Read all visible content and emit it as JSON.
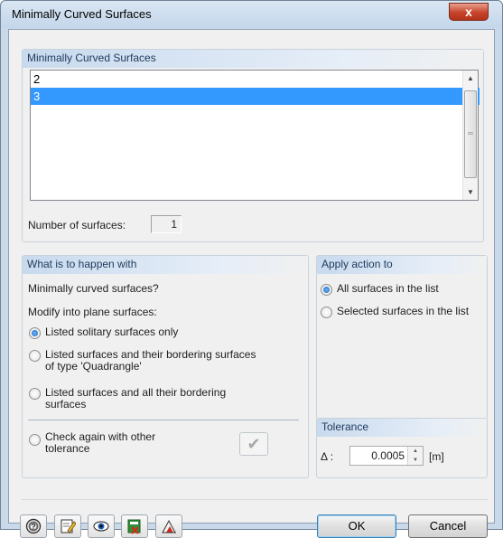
{
  "window": {
    "title": "Minimally Curved Surfaces",
    "close_label": "x"
  },
  "list_group": {
    "header": "Minimally Curved Surfaces",
    "items": [
      "2",
      "3"
    ],
    "selected_index": 1,
    "number_label": "Number of surfaces:",
    "number_value": "1"
  },
  "happen_group": {
    "header": "What is to happen with",
    "question": "Minimally curved surfaces?",
    "modify_label": "Modify into plane surfaces:",
    "options": [
      {
        "line1": "Listed solitary surfaces only",
        "line2": "",
        "checked": true
      },
      {
        "line1": "Listed surfaces and their bordering surfaces",
        "line2": "of type 'Quadrangle'",
        "checked": false
      },
      {
        "line1": "Listed surfaces and all their bordering",
        "line2": "surfaces",
        "checked": false
      },
      {
        "line1": "Check again with other",
        "line2": "tolerance",
        "checked": false
      }
    ],
    "check_icon": "checkmark-icon"
  },
  "apply_group": {
    "header": "Apply action to",
    "options": [
      {
        "label": "All surfaces in the list",
        "checked": true
      },
      {
        "label": "Selected surfaces in the list",
        "checked": false
      }
    ]
  },
  "tolerance_group": {
    "header": "Tolerance",
    "delta_label": "Δ :",
    "value": "0.0005",
    "unit": "[m]"
  },
  "buttons": {
    "ok": "OK",
    "cancel": "Cancel",
    "toolbar_icons": [
      "help-icon",
      "edit-icon",
      "view-icon",
      "export-icon",
      "warning-icon"
    ]
  },
  "colors": {
    "accent": "#3399ff",
    "group_header": "#c8daee",
    "title_bar": "#c4d6ea"
  }
}
